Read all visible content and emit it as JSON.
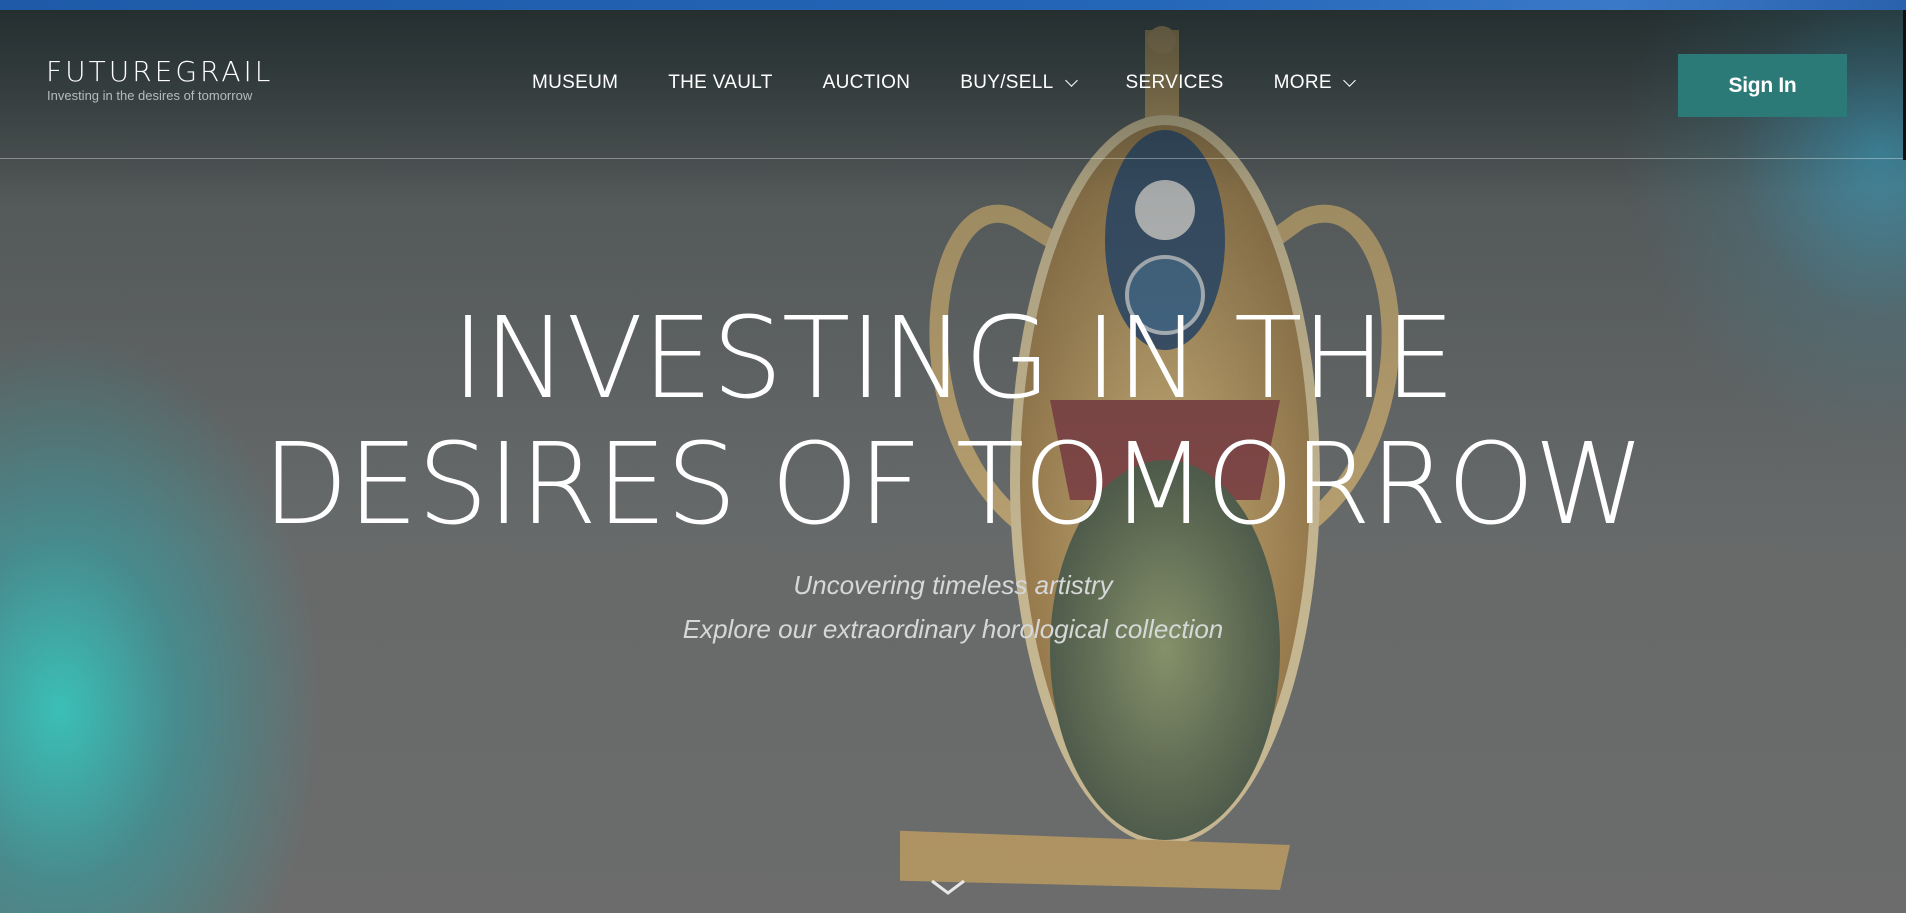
{
  "brand": {
    "name": "FUTUREGRAIL",
    "tagline": "Investing in the desires of tomorrow"
  },
  "nav": {
    "items": [
      {
        "label": "MUSEUM",
        "dropdown": false
      },
      {
        "label": "THE VAULT",
        "dropdown": false
      },
      {
        "label": "AUCTION",
        "dropdown": false
      },
      {
        "label": "BUY/SELL",
        "dropdown": true
      },
      {
        "label": "SERVICES",
        "dropdown": false
      },
      {
        "label": "MORE",
        "dropdown": true
      }
    ],
    "signin_label": "Sign In"
  },
  "hero": {
    "headline_line1": "INVESTING IN THE",
    "headline_line2": "DESIRES OF TOMORROW",
    "subtitle_line1": "Uncovering timeless artistry",
    "subtitle_line2": "Explore our extraordinary horological collection",
    "scroll_icon": "chevron-down-icon"
  },
  "colors": {
    "signin_bg": "#2b7a78",
    "browser_bar": "#1e5aa8",
    "text": "#ffffff"
  }
}
